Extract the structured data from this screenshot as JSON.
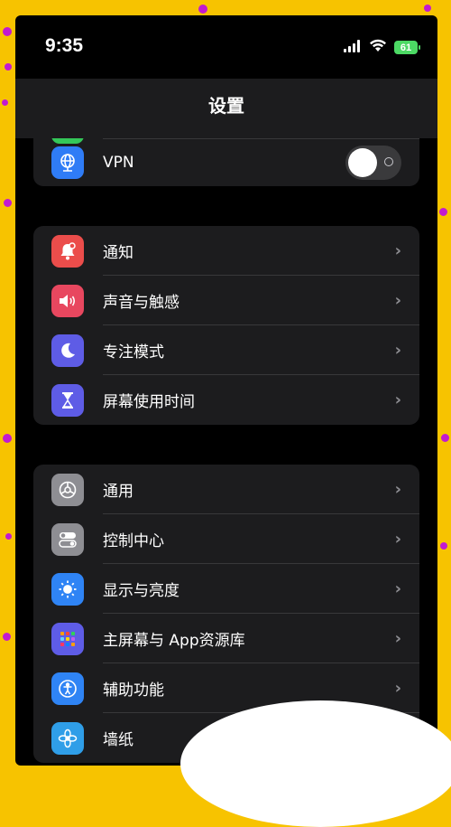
{
  "status_bar": {
    "time": "9:35",
    "battery": "61"
  },
  "nav": {
    "title": "设置"
  },
  "group_top": {
    "vpn": {
      "label": "VPN",
      "toggle_on": false
    }
  },
  "group_attention": {
    "items": [
      {
        "label": "通知",
        "icon": "bell-icon",
        "color": "#eb4d4b"
      },
      {
        "label": "声音与触感",
        "icon": "speaker-icon",
        "color": "#e8475f"
      },
      {
        "label": "专注模式",
        "icon": "moon-icon",
        "color": "#5e5ce6"
      },
      {
        "label": "屏幕使用时间",
        "icon": "hourglass-icon",
        "color": "#5e5ce6"
      }
    ]
  },
  "group_general": {
    "items": [
      {
        "label": "通用",
        "icon": "gear-icon",
        "color": "#8e8e93"
      },
      {
        "label": "控制中心",
        "icon": "switches-icon",
        "color": "#8e8e93"
      },
      {
        "label": "显示与亮度",
        "icon": "sun-icon",
        "color": "#2f84f5"
      },
      {
        "label": "主屏幕与 App资源库",
        "icon": "app-grid-icon",
        "color": "#5e5ce6"
      },
      {
        "label": "辅助功能",
        "icon": "accessibility-icon",
        "color": "#2f84f5"
      },
      {
        "label": "墙纸",
        "icon": "flower-icon",
        "color": "#2f9ee8"
      }
    ]
  },
  "colors": {
    "accent_green": "#4cd964",
    "background_border": "#f7c300"
  }
}
